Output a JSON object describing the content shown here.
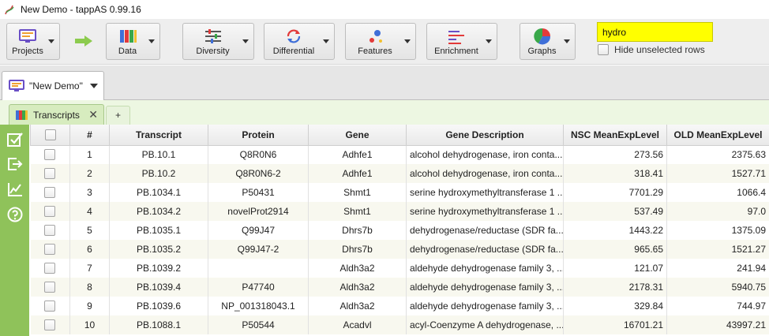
{
  "window": {
    "title": "New Demo - tappAS 0.99.16"
  },
  "toolbar": {
    "buttons": [
      {
        "label": "Projects",
        "icon": "monitor-icon"
      },
      {
        "label": "Data",
        "icon": "data-bars-icon"
      },
      {
        "label": "Diversity",
        "icon": "sliders-icon"
      },
      {
        "label": "Differential",
        "icon": "refresh-icon"
      },
      {
        "label": "Features",
        "icon": "dots-icon"
      },
      {
        "label": "Enrichment",
        "icon": "bars-list-icon"
      },
      {
        "label": "Graphs",
        "icon": "pie-chart-icon"
      }
    ],
    "search_value": "hydro",
    "hide_unselected_label": "Hide unselected rows"
  },
  "project_tab": {
    "label": "\"New Demo\""
  },
  "sub_tabs": {
    "active_label": "Transcripts",
    "close_glyph": "✕",
    "add_label": "+"
  },
  "table": {
    "columns": [
      "",
      "#",
      "Transcript",
      "Protein",
      "Gene",
      "Gene Description",
      "NSC MeanExpLevel",
      "OLD MeanExpLevel"
    ],
    "rows": [
      {
        "num": "1",
        "transcript": "PB.10.1",
        "protein": "Q8R0N6",
        "gene": "Adhfe1",
        "description": "alcohol dehydrogenase, iron conta...",
        "nsc": "273.56",
        "old": "2375.63"
      },
      {
        "num": "2",
        "transcript": "PB.10.2",
        "protein": "Q8R0N6-2",
        "gene": "Adhfe1",
        "description": "alcohol dehydrogenase, iron conta...",
        "nsc": "318.41",
        "old": "1527.71"
      },
      {
        "num": "3",
        "transcript": "PB.1034.1",
        "protein": "P50431",
        "gene": "Shmt1",
        "description": "serine hydroxymethyltransferase 1 ...",
        "nsc": "7701.29",
        "old": "1066.4"
      },
      {
        "num": "4",
        "transcript": "PB.1034.2",
        "protein": "novelProt2914",
        "gene": "Shmt1",
        "description": "serine hydroxymethyltransferase 1 ...",
        "nsc": "537.49",
        "old": "97.0"
      },
      {
        "num": "5",
        "transcript": "PB.1035.1",
        "protein": "Q99J47",
        "gene": "Dhrs7b",
        "description": "dehydrogenase/reductase (SDR fa...",
        "nsc": "1443.22",
        "old": "1375.09"
      },
      {
        "num": "6",
        "transcript": "PB.1035.2",
        "protein": "Q99J47-2",
        "gene": "Dhrs7b",
        "description": "dehydrogenase/reductase (SDR fa...",
        "nsc": "965.65",
        "old": "1521.27"
      },
      {
        "num": "7",
        "transcript": "PB.1039.2",
        "protein": "",
        "gene": "Aldh3a2",
        "description": "aldehyde dehydrogenase family 3, ...",
        "nsc": "121.07",
        "old": "241.94"
      },
      {
        "num": "8",
        "transcript": "PB.1039.4",
        "protein": "P47740",
        "gene": "Aldh3a2",
        "description": "aldehyde dehydrogenase family 3, ...",
        "nsc": "2178.31",
        "old": "5940.75"
      },
      {
        "num": "9",
        "transcript": "PB.1039.6",
        "protein": "NP_001318043.1",
        "gene": "Aldh3a2",
        "description": "aldehyde dehydrogenase family 3, ...",
        "nsc": "329.84",
        "old": "744.97"
      },
      {
        "num": "10",
        "transcript": "PB.1088.1",
        "protein": "P50544",
        "gene": "Acadvl",
        "description": "acyl-Coenzyme A dehydrogenase, ...",
        "nsc": "16701.21",
        "old": "43997.21"
      }
    ]
  },
  "colors": {
    "search_highlight": "#ffff00",
    "sidebar_green": "#8fc25a",
    "subtab_bg": "#edf7e2",
    "arrow_green": "#8ccb4e"
  }
}
